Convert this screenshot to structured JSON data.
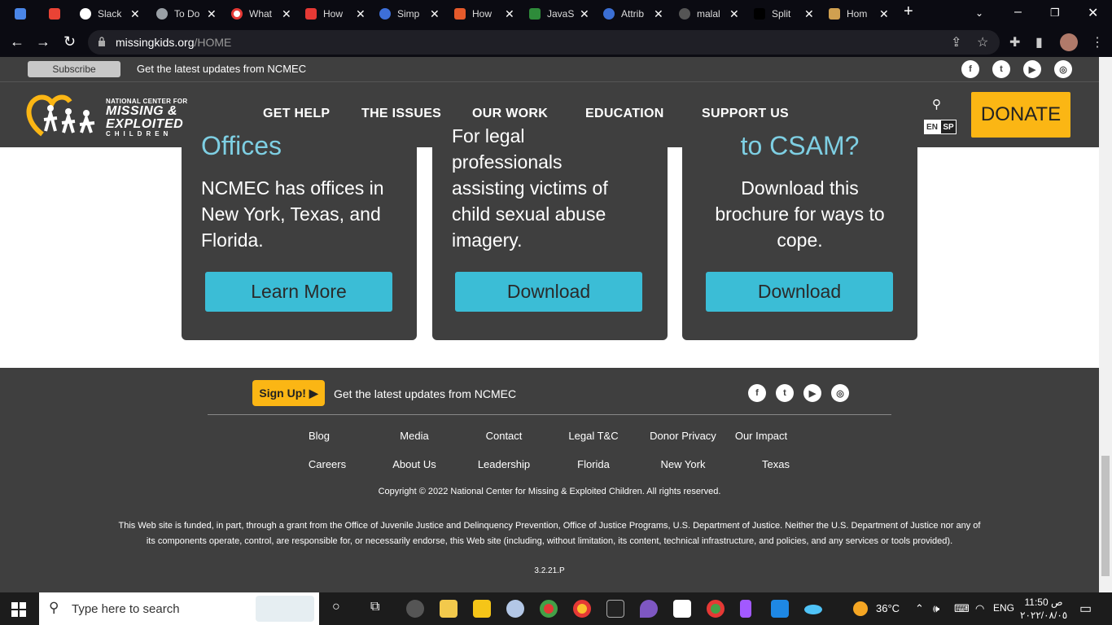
{
  "browser": {
    "tabs": [
      {
        "label": "",
        "color": "#4a86e8"
      },
      {
        "label": "",
        "color": "#ea4335"
      },
      {
        "label": "Slack",
        "color": "#ffffff"
      },
      {
        "label": "To Do",
        "color": "#9aa0a6"
      },
      {
        "label": "What",
        "color": "#ffffff"
      },
      {
        "label": "How",
        "color": "#e53935"
      },
      {
        "label": "Simp",
        "color": "#3d6fd9"
      },
      {
        "label": "How",
        "color": "#e55a2b"
      },
      {
        "label": "JavaS",
        "color": "#2e8b3a"
      },
      {
        "label": "Attrib",
        "color": "#3b6fd4"
      },
      {
        "label": "malal",
        "color": "#555555"
      },
      {
        "label": "Split",
        "color": "#000000"
      },
      {
        "label": "Hom",
        "color": "#d0a050"
      }
    ],
    "new_tab": "+",
    "url_domain": "missingkids.org",
    "url_path": "/HOME"
  },
  "top_strip": {
    "subscribe": "Subscribe",
    "text": "Get the latest updates from NCMEC"
  },
  "header": {
    "logo_line1": "NATIONAL CENTER FOR",
    "logo_line2": "MISSING &",
    "logo_line3": "EXPLOITED",
    "logo_line4": "CHILDREN",
    "menu": [
      "GET HELP",
      "THE ISSUES",
      "OUR WORK",
      "EDUCATION",
      "SUPPORT US"
    ],
    "lang_en": "EN",
    "lang_sp": "SP",
    "donate": "DONATE"
  },
  "cards": [
    {
      "title": "Offices",
      "text_lines": [
        "NCMEC has offices in",
        "New York, Texas, and",
        "Florida."
      ],
      "button": "Learn More"
    },
    {
      "title": "",
      "text_lines": [
        "For legal",
        "professionals",
        "assisting victims of",
        "child sexual abuse",
        "imagery."
      ],
      "button": "Download"
    },
    {
      "title": "to CSAM?",
      "text_lines": [
        "Download this",
        "brochure for ways to",
        "cope."
      ],
      "button": "Download"
    }
  ],
  "footer": {
    "signup": "Sign Up! ▶",
    "text": "Get the latest updates from NCMEC",
    "links_row1": [
      "Blog",
      "Media",
      "Contact",
      "Legal T&C",
      "Donor Privacy",
      "Our Impact"
    ],
    "links_row2": [
      "Careers",
      "About Us",
      "Leadership",
      "Florida",
      "New York",
      "Texas"
    ],
    "copyright": "Copyright © 2022 National Center for Missing & Exploited Children. All rights reserved.",
    "disclaimer": "This Web site is funded, in part, through a grant from the Office of Juvenile Justice and Delinquency Prevention, Office of Justice Programs, U.S. Department of Justice. Neither the U.S. Department of Justice nor any of its components operate, control, are responsible for, or necessarily endorse, this Web site (including, without limitation, its content, technical infrastructure, and policies, and any services or tools provided).",
    "version": "3.2.21.P"
  },
  "taskbar": {
    "search_placeholder": "Type here to search",
    "weather": "36°C",
    "language": "ENG",
    "time": "11:50 ص",
    "date": "٢٠٢٢/٠٨/٠٥"
  },
  "colors": {
    "dark": "#3f3f3f",
    "accent_yellow": "#fbb614",
    "accent_teal": "#3bbdd6",
    "title_teal": "#7ecfe3"
  }
}
